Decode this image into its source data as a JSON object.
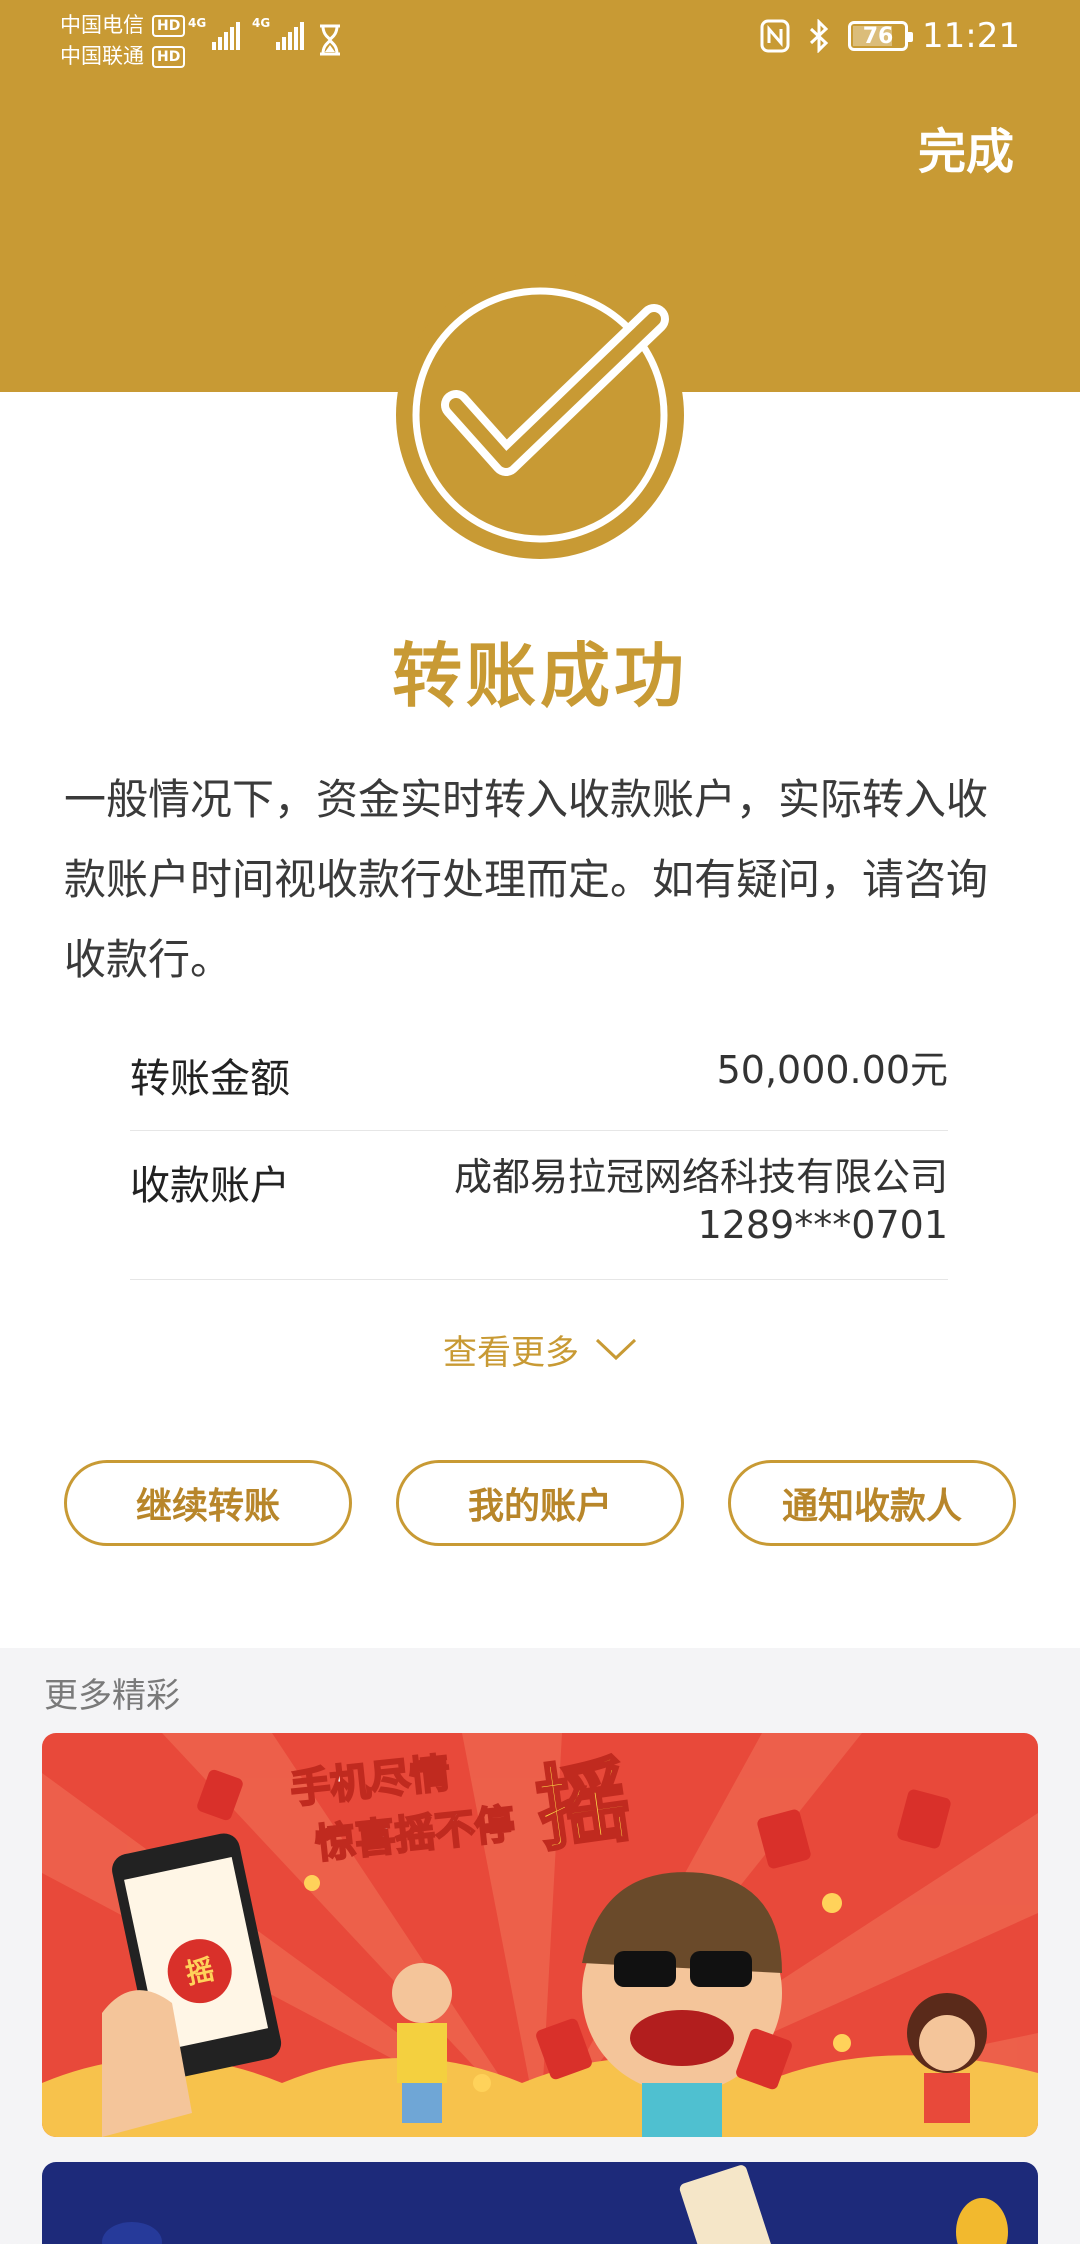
{
  "status_bar": {
    "carrier1": "中国电信",
    "carrier2": "中国联通",
    "hd": "HD",
    "network1": "4G",
    "network2": "4G",
    "battery": "76",
    "time": "11:21"
  },
  "header": {
    "done_label": "完成"
  },
  "result": {
    "title": "转账成功",
    "notice": "一般情况下，资金实时转入收款账户，实际转入收款账户时间视收款行处理而定。如有疑问，请咨询收款行。"
  },
  "details": {
    "amount_label": "转账金额",
    "amount_value": "50,000.00元",
    "payee_label": "收款账户",
    "payee_name": "成都易拉冠网络科技有限公司",
    "payee_account": "1289***0701",
    "more_label": "查看更多"
  },
  "actions": {
    "continue_label": "继续转账",
    "my_account_label": "我的账户",
    "notify_label": "通知收款人"
  },
  "more": {
    "title": "更多精彩",
    "banner1_line1": "手机尽情",
    "banner1_line2": "惊喜摇不停",
    "banner1_big": "摇",
    "banner1_badge": "摇"
  },
  "colors": {
    "accent": "#c89a34",
    "banner_red": "#e8493a",
    "banner_blue": "#1d2a7a"
  }
}
